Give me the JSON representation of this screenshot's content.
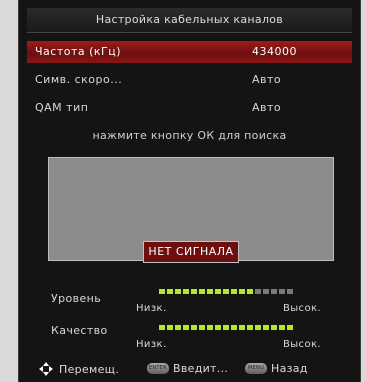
{
  "title": "Настройка кабельных каналов",
  "rows": [
    {
      "label": "Частота (кГц)",
      "value": "434000",
      "selected": true
    },
    {
      "label": "Симв. скоро...",
      "value": "Авто",
      "selected": false
    },
    {
      "label": "QAM тип",
      "value": "Авто",
      "selected": false
    }
  ],
  "hint": "нажмите кнопку ОК для поиска",
  "no_signal": "НЕТ СИГНАЛА",
  "meters": {
    "level": {
      "label": "Уровень",
      "low": "Низк.",
      "high": "Высок.",
      "filled_segments": 12,
      "total_segments": 17
    },
    "quality": {
      "label": "Качество",
      "low": "Низк.",
      "high": "Высок.",
      "filled_segments": 17,
      "total_segments": 17
    }
  },
  "footer": {
    "move": "Перемещ.",
    "enter": "Введит...",
    "enter_key": "ENTER",
    "back": "Назад",
    "back_key": "MENU"
  },
  "colors": {
    "selected": "#8a1515",
    "meter_on": "#b9e52a",
    "meter_off": "#7a7a7a"
  }
}
